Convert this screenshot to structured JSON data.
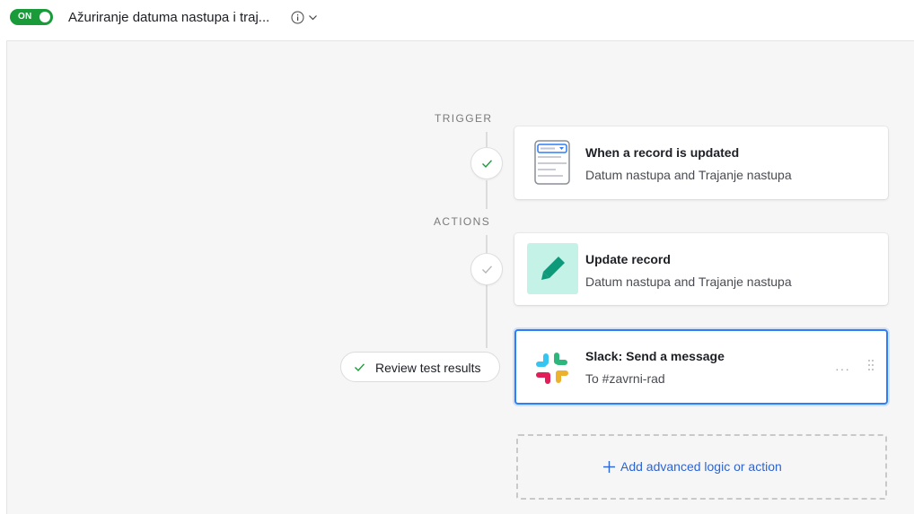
{
  "header": {
    "toggle_label": "ON",
    "automation_title": "Ažuriranje datuma nastupa i traj...",
    "info_icon": "info-circle-icon",
    "chevron_icon": "chevron-down-icon"
  },
  "flow": {
    "trigger_label": "TRIGGER",
    "actions_label": "ACTIONS",
    "trigger": {
      "icon": "form-record-icon",
      "title": "When a record is updated",
      "subtitle": "Datum nastupa and Trajanje nastupa"
    },
    "actions": [
      {
        "icon": "pencil-icon",
        "title": "Update record",
        "subtitle": "Datum nastupa and Trajanje nastupa"
      },
      {
        "icon": "slack-icon",
        "title": "Slack: Send a message",
        "subtitle": "To #zavrni-rad",
        "more": "···"
      }
    ],
    "review_button": "Review test results",
    "add_button": "Add advanced logic or action"
  },
  "colors": {
    "toggle_on": "#1a9b3a",
    "accent_blue": "#2d7ff9",
    "link_blue": "#2d64d4",
    "pencil_bg": "#c4f2e6",
    "pencil_fg": "#0e9a7a",
    "check_green": "#1a9b3a"
  }
}
